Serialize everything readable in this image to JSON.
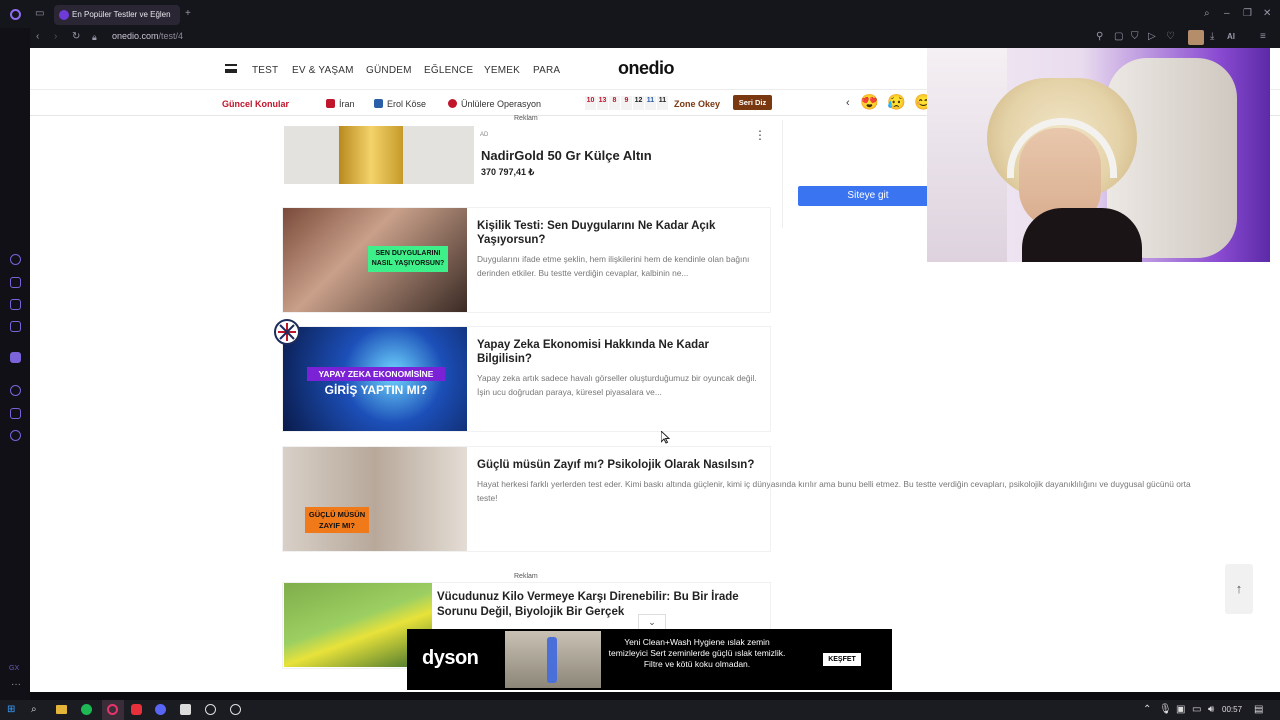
{
  "browser": {
    "tab_title": "En Popüler Testler ve Eğlen",
    "url_host": "onedio.com",
    "url_path": "/test/4",
    "ai_label": "AI"
  },
  "site": {
    "logo": "onedio",
    "nav": [
      "TEST",
      "EV & YAŞAM",
      "GÜNDEM",
      "EĞLENCE",
      "YEMEK",
      "PARA"
    ],
    "topics_label": "Güncel Konular",
    "topics": [
      "İran",
      "Erol Köse",
      "Ünlülere Operasyon"
    ],
    "zone_numbers": [
      "10",
      "13",
      "8",
      "9",
      "12",
      "11",
      "11"
    ],
    "zone_label": "Zone Okey",
    "zone_button": "Seri Diz"
  },
  "ad_top": {
    "label": "Reklam",
    "badge": "AD",
    "title": "NadirGold 50 Gr Külçe Altın",
    "price": "370 797,41 ₺",
    "cta": "Siteye git"
  },
  "cards": [
    {
      "title": "Kişilik Testi: Sen Duygularını Ne Kadar Açık Yaşıyorsun?",
      "desc": "Duygularını ifade etme şeklin, hem ilişkilerini hem de kendinle olan bağını derinden etkiler. Bu testte verdiğin cevaplar, kalbinin ne...",
      "thumb_text": "SEN DUYGULARINI NASIL YAŞIYORSUN?"
    },
    {
      "title": "Yapay Zeka Ekonomisi Hakkında Ne Kadar Bilgilisin?",
      "desc": "Yapay zeka artık sadece havalı görseller oluşturduğumuz bir oyuncak değil. İşin ucu doğrudan paraya, küresel piyasalara ve...",
      "thumb_text_1": "YAPAY ZEKA EKONOMİSİNE",
      "thumb_text_2": "GİRİŞ YAPTIN MI?"
    },
    {
      "title": "Güçlü müsün Zayıf mı? Psikolojik Olarak Nasılsın?",
      "desc": "Hayat herkesi farklı yerlerden test eder. Kimi baskı altında güçlenir, kimi iç dünyasında kırılır ama bunu belli etmez. Bu testte verdiğin cevapları, psikolojik dayanıklılığını ve duygusal gücünü orta",
      "desc2": "teste!",
      "thumb_text": "GÜÇLÜ MÜSÜN ZAYIF MI?"
    }
  ],
  "ad_bottom": {
    "label": "Reklam",
    "title": "Vücudunuz Kilo Vermeye Karşı Direnebilir: Bu Bir İrade Sorunu Değil, Biyolojik Bir Gerçek"
  },
  "dyson_ad": {
    "brand": "dyson",
    "text": "Yeni Clean+Wash Hygiene ıslak zemin temizleyici Sert zeminlerde güçlü ıslak temizlik. Filtre ve kötü koku olmadan.",
    "button": "KEŞFET"
  },
  "taskbar": {
    "time": "00:57"
  },
  "colors": {
    "accent_red": "#c0152b",
    "cta_blue": "#3b74f0",
    "seri_brown": "#7a3810",
    "chrome_purple": "#7b63d9"
  }
}
